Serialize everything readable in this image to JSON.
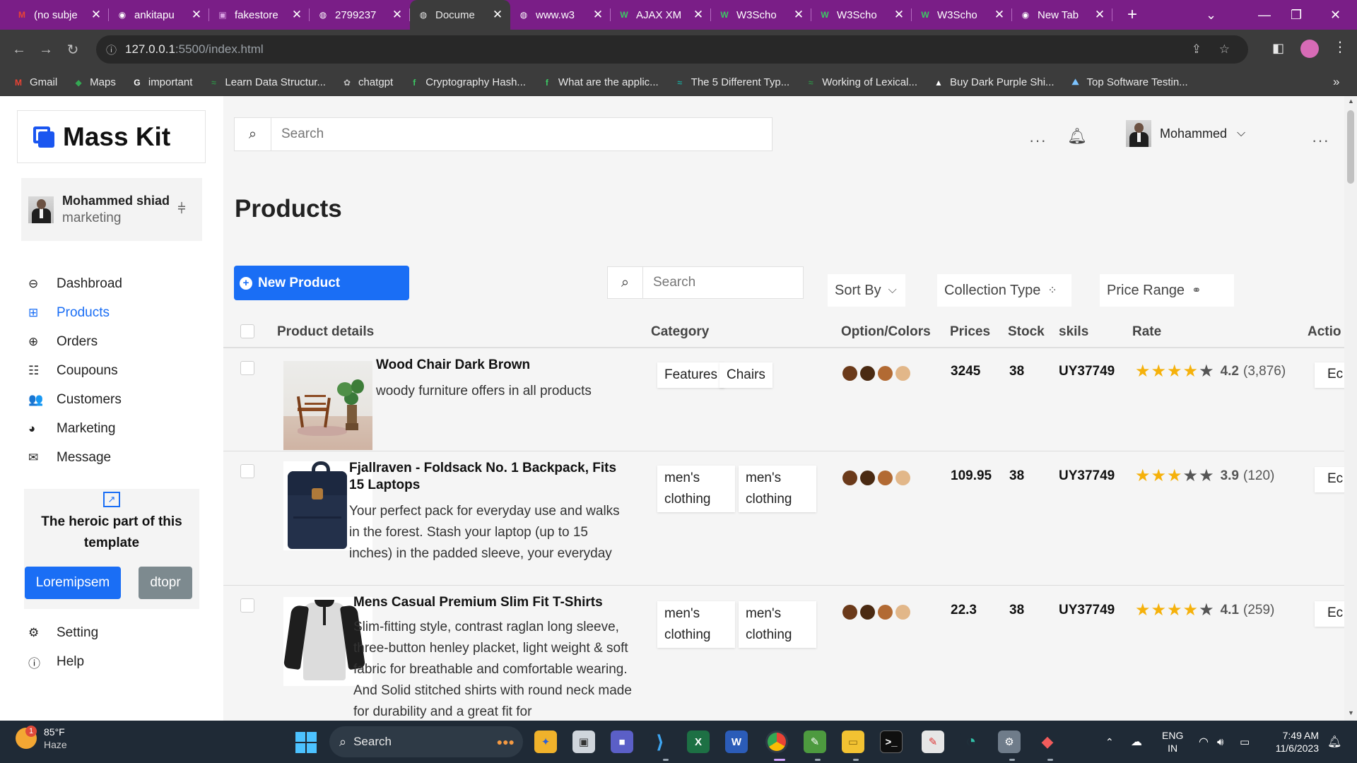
{
  "browser": {
    "tabs": [
      {
        "title": "(no subje",
        "icon": "gmail-icon",
        "glyph": "M",
        "color": "#ea4335"
      },
      {
        "title": "ankitapu",
        "icon": "github-icon",
        "glyph": "◉",
        "color": "#ffffff"
      },
      {
        "title": "fakestore",
        "icon": "fakestore-icon",
        "glyph": "▣",
        "color": "#d9a0e3"
      },
      {
        "title": "2799237",
        "icon": "globe-icon",
        "glyph": "◍",
        "color": "#ffffff"
      },
      {
        "title": "Docume",
        "icon": "globe-icon",
        "glyph": "◍",
        "color": "#e8e8e8"
      },
      {
        "title": "www.w3",
        "icon": "globe-icon",
        "glyph": "◍",
        "color": "#ffffff"
      },
      {
        "title": "AJAX XM",
        "icon": "w3schools-icon",
        "glyph": "W",
        "color": "#3cc864"
      },
      {
        "title": "W3Scho",
        "icon": "w3schools-icon",
        "glyph": "W",
        "color": "#3cc864"
      },
      {
        "title": "W3Scho",
        "icon": "w3schools-icon",
        "glyph": "W",
        "color": "#3cc864"
      },
      {
        "title": "W3Scho",
        "icon": "w3schools-icon",
        "glyph": "W",
        "color": "#3cc864"
      },
      {
        "title": "New Tab",
        "icon": "chrome-icon",
        "glyph": "◉",
        "color": "#ffffff"
      }
    ],
    "active_tab": 4,
    "url_host": "127.0.0.1",
    "url_path": ":5500/index.html",
    "bookmarks": [
      {
        "label": "Gmail",
        "icon": "gmail-icon",
        "glyph": "M",
        "color": "#ea4335"
      },
      {
        "label": "Maps",
        "icon": "maps-icon",
        "glyph": "◆",
        "color": "#34a853"
      },
      {
        "label": "important",
        "icon": "google-icon",
        "glyph": "G",
        "color": "#ffffff"
      },
      {
        "label": "Learn Data Structur...",
        "icon": "gfg-icon",
        "glyph": "≈",
        "color": "#2f8d46"
      },
      {
        "label": "chatgpt",
        "icon": "openai-icon",
        "glyph": "✿",
        "color": "#bfbfbf"
      },
      {
        "label": "Cryptography Hash...",
        "icon": "doc-icon",
        "glyph": "f",
        "color": "#3cc864"
      },
      {
        "label": "What are the applic...",
        "icon": "doc-icon",
        "glyph": "f",
        "color": "#3cc864"
      },
      {
        "label": "The 5 Different Typ...",
        "icon": "wave-icon",
        "glyph": "≈",
        "color": "#1aa59a"
      },
      {
        "label": "Working of Lexical...",
        "icon": "gfg-icon",
        "glyph": "≈",
        "color": "#2f8d46"
      },
      {
        "label": "Buy Dark Purple Shi...",
        "icon": "triangle-icon",
        "glyph": "▲",
        "color": "#ffffff"
      },
      {
        "label": "Top Software Testin...",
        "icon": "mountain-icon",
        "glyph": "⛰",
        "color": "#7cc3ff"
      }
    ]
  },
  "sidebar": {
    "brand": "Mass Kit",
    "profile": {
      "name": "Mohammed shiad",
      "role": "marketing"
    },
    "items": [
      {
        "label": "Dashbroad",
        "icon": "dashboard-icon",
        "glyph": "⊖"
      },
      {
        "label": "Products",
        "icon": "grid-icon",
        "glyph": "⊞"
      },
      {
        "label": "Orders",
        "icon": "cart-icon",
        "glyph": "⊕"
      },
      {
        "label": "Coupouns",
        "icon": "coupon-icon",
        "glyph": "☷"
      },
      {
        "label": "Customers",
        "icon": "users-icon",
        "glyph": "👥"
      },
      {
        "label": "Marketing",
        "icon": "pie-chart-icon",
        "glyph": "◕"
      },
      {
        "label": "Message",
        "icon": "envelope-icon",
        "glyph": "✉"
      }
    ],
    "active_item": "Products",
    "promo": {
      "text": "The heroic part of this template",
      "primary_button": "Loremipsem",
      "secondary_button": "dtopr"
    },
    "footer_items": [
      {
        "label": "Setting",
        "icon": "gear-icon",
        "glyph": "⚙"
      },
      {
        "label": "Help",
        "icon": "info-icon",
        "glyph": "ⓘ"
      }
    ]
  },
  "header": {
    "search_placeholder": "Search",
    "user_name": "Mohammed"
  },
  "main": {
    "title": "Products",
    "new_button": "New Product",
    "search_placeholder": "Search",
    "filters": [
      "Sort By",
      "Collection Type",
      "Price Range"
    ],
    "columns": [
      "Product details",
      "Category",
      "Option/Colors",
      "Prices",
      "Stock",
      "skils",
      "Rate",
      "Actio"
    ],
    "products": [
      {
        "title": "Wood Chair Dark Brown",
        "description": "woody furniture offers in all products",
        "tags": [
          "Features",
          "Chairs"
        ],
        "colors": [
          "#6b3a1a",
          "#4a2a12",
          "#b26a33",
          "#e2b789"
        ],
        "price": "3245",
        "stock": "38",
        "sku": "UY37749",
        "rating": 4.2,
        "rating_label": "4.2",
        "reviews": "(3,876)",
        "action": "Ec"
      },
      {
        "title": "Fjallraven - Foldsack No. 1 Backpack, Fits 15 Laptops",
        "description": "Your perfect pack for everyday use and walks in the forest. Stash your laptop (up to 15 inches) in the padded sleeve, your everyday",
        "tags": [
          "men's clothing",
          "men's clothing"
        ],
        "colors": [
          "#6b3a1a",
          "#4a2a12",
          "#b26a33",
          "#e2b789"
        ],
        "price": "109.95",
        "stock": "38",
        "sku": "UY37749",
        "rating": 3.9,
        "rating_label": "3.9",
        "reviews": "(120)",
        "action": "Ec"
      },
      {
        "title": "Mens Casual Premium Slim Fit T-Shirts",
        "description": "Slim-fitting style, contrast raglan long sleeve, three-button henley placket, light weight & soft fabric for breathable and comfortable wearing. And Solid stitched shirts with round neck made for durability and a great fit for",
        "tags": [
          "men's clothing",
          "men's clothing"
        ],
        "colors": [
          "#6b3a1a",
          "#4a2a12",
          "#b26a33",
          "#e2b789"
        ],
        "price": "22.3",
        "stock": "38",
        "sku": "UY37749",
        "rating": 4.1,
        "rating_label": "4.1",
        "reviews": "(259)",
        "action": "Ec"
      }
    ]
  },
  "taskbar": {
    "weather_temp": "85°F",
    "weather_desc": "Haze",
    "weather_badge": "1",
    "search_label": "Search",
    "lang": "ENG",
    "region": "IN",
    "time": "7:49 AM",
    "date": "11/6/2023"
  }
}
